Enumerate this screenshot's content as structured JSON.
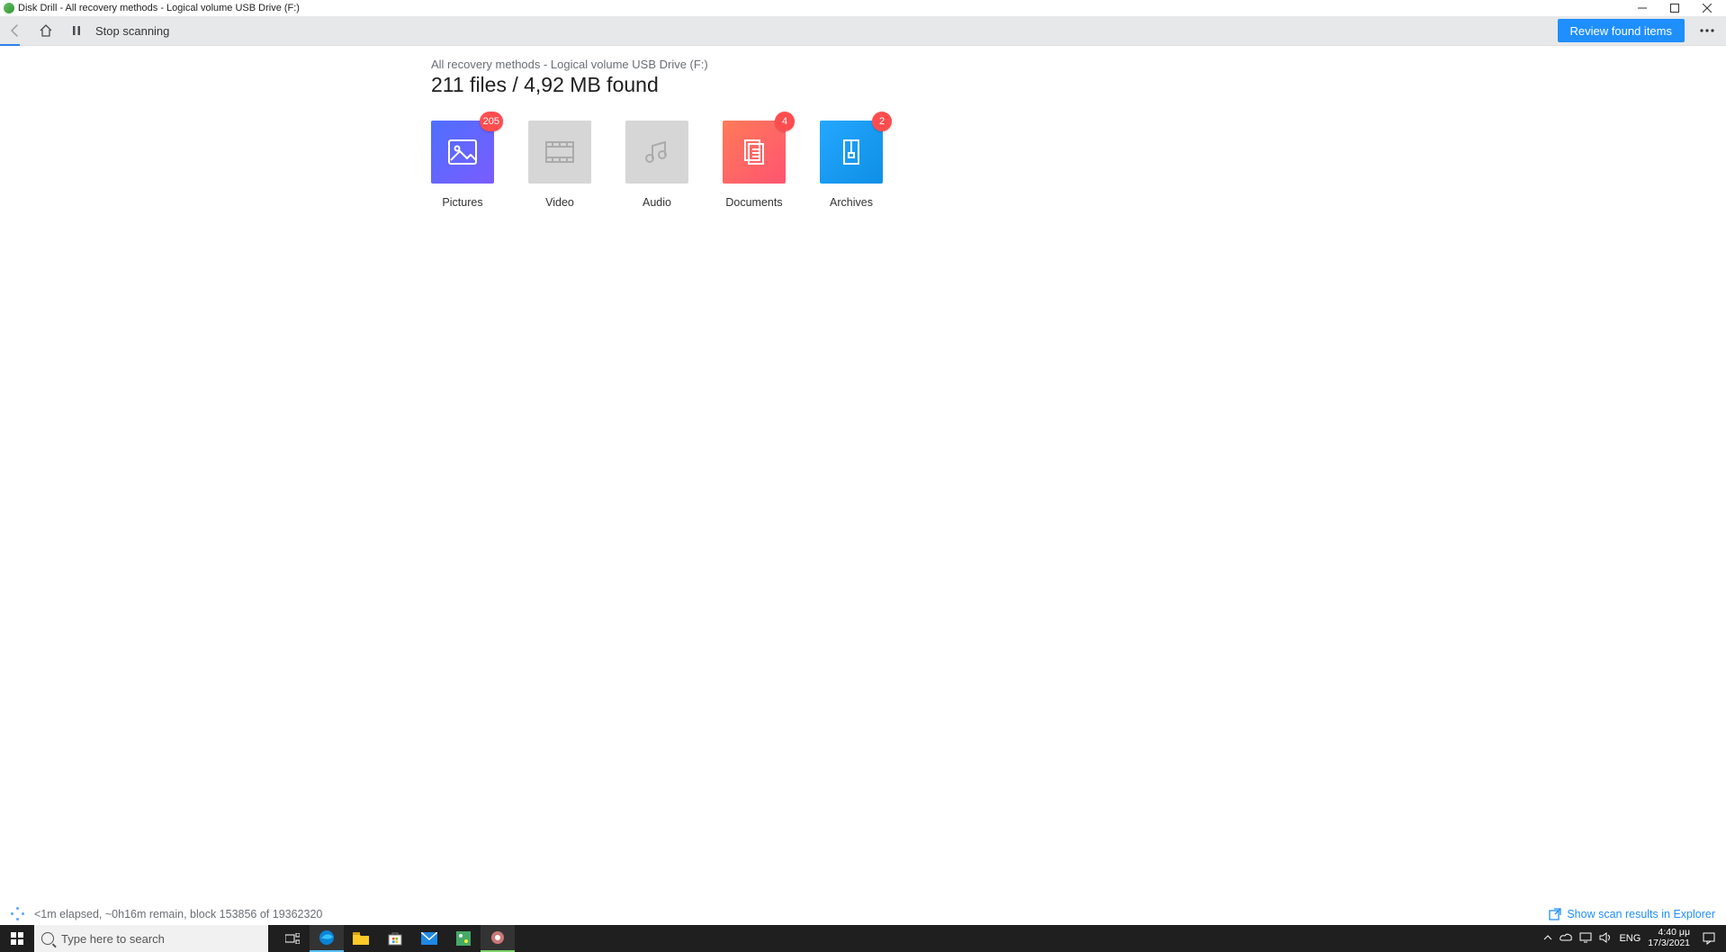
{
  "window": {
    "title": "Disk Drill - All recovery methods - Logical volume USB Drive (F:)"
  },
  "toolbar": {
    "stop_label": "Stop scanning",
    "review_label": "Review found items"
  },
  "breadcrumb": "All recovery methods - Logical volume USB Drive (F:)",
  "summary": "211 files / 4,92 MB found",
  "tiles": [
    {
      "key": "pictures",
      "label": "Pictures",
      "badge": "205"
    },
    {
      "key": "video",
      "label": "Video",
      "badge": null
    },
    {
      "key": "audio",
      "label": "Audio",
      "badge": null
    },
    {
      "key": "documents",
      "label": "Documents",
      "badge": "4"
    },
    {
      "key": "archives",
      "label": "Archives",
      "badge": "2"
    }
  ],
  "status": {
    "text": "<1m elapsed, ~0h16m remain, block 153856 of 19362320",
    "link": "Show scan results in Explorer"
  },
  "taskbar": {
    "search_placeholder": "Type here to search",
    "lang": "ENG",
    "time": "4:40 μμ",
    "date": "17/3/2021"
  }
}
